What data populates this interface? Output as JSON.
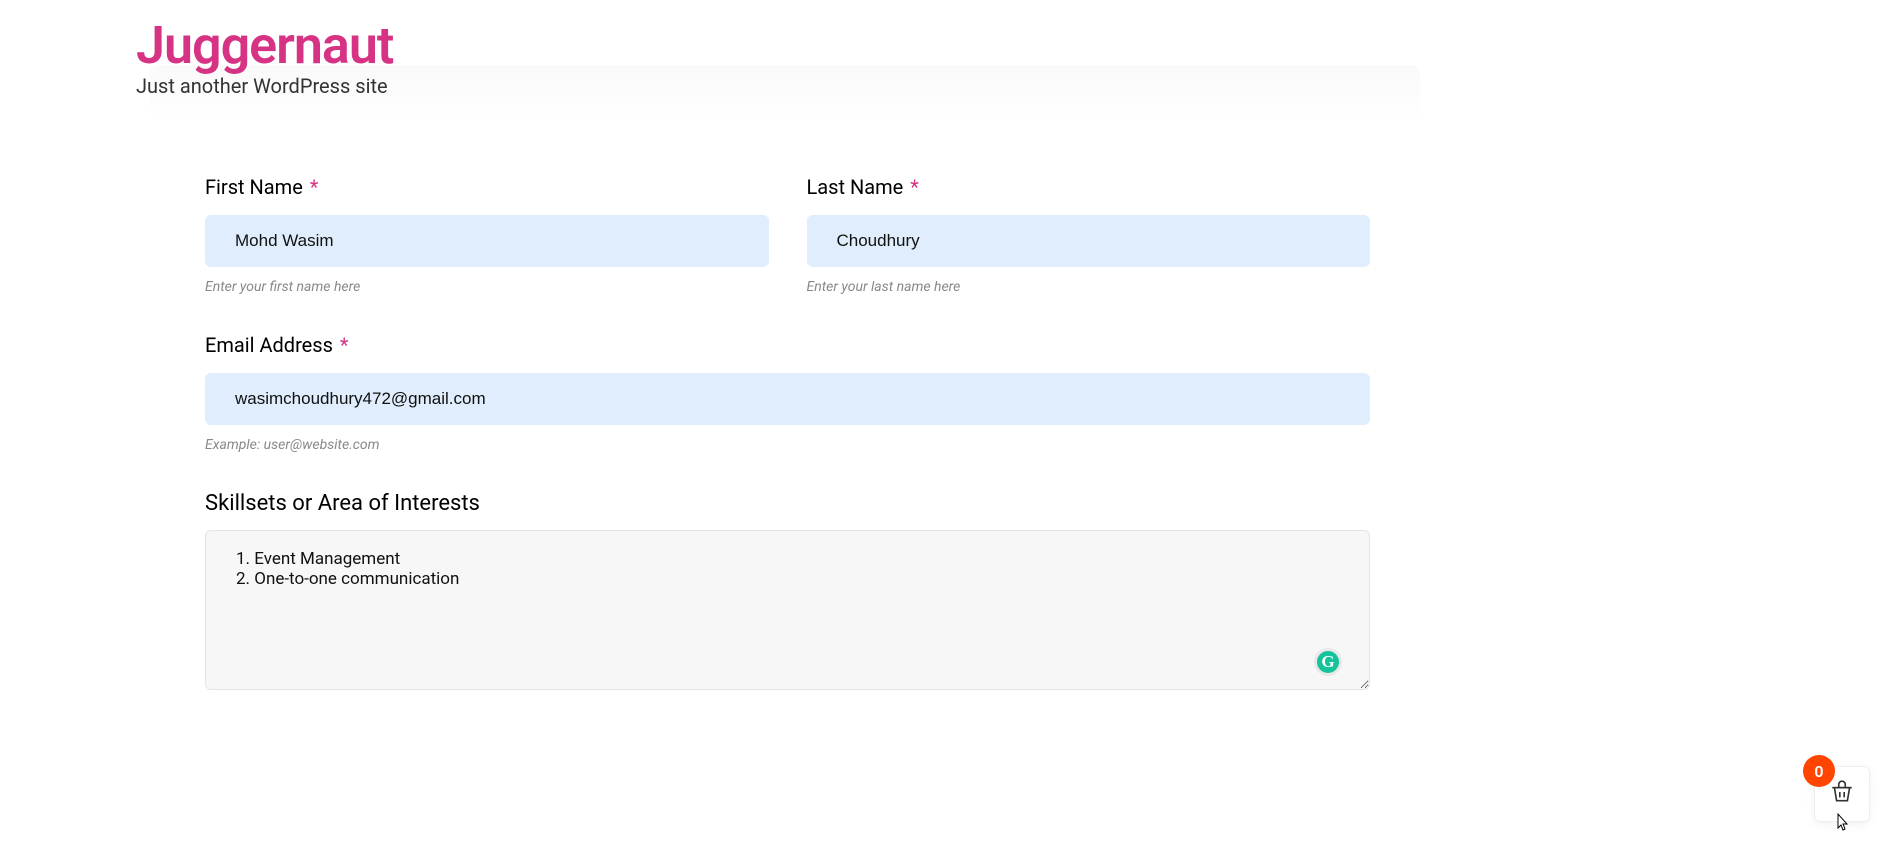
{
  "site": {
    "title": "Juggernaut",
    "tagline": "Just another WordPress site"
  },
  "form": {
    "firstName": {
      "label": "First Name",
      "value": "Mohd Wasim",
      "help": "Enter your first name here",
      "required": true
    },
    "lastName": {
      "label": "Last Name",
      "value": "Choudhury",
      "help": "Enter your last name here",
      "required": true
    },
    "email": {
      "label": "Email Address",
      "value": "wasimchoudhury472@gmail.com",
      "help": "Example: user@website.com",
      "required": true
    },
    "skillsets": {
      "label": "Skillsets or Area of Interests",
      "value": "1. Event Management\n2. One-to-one communication"
    }
  },
  "cart": {
    "count": "0"
  },
  "asterisk": "*",
  "grammarly": "G"
}
